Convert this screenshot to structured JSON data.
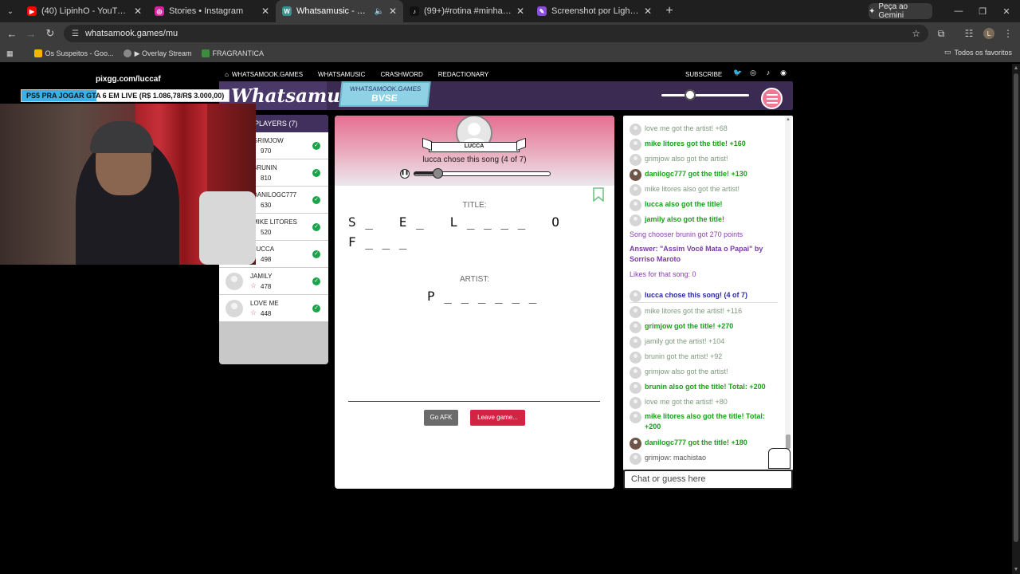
{
  "browser": {
    "tabs": [
      {
        "title": "(40) LipinhO - YouTube",
        "icon": "youtube-icon",
        "color": "#ff0000"
      },
      {
        "title": "Stories • Instagram",
        "icon": "instagram-icon",
        "color": "#d6249f"
      },
      {
        "title": "Whatsamusic - Name That",
        "icon": "whatsamusic-icon",
        "color": "#3a8f8f"
      },
      {
        "title": "(99+)#rotina #minharotina #fo",
        "icon": "tiktok-icon",
        "color": "#111111"
      },
      {
        "title": "Screenshot por Lightshot",
        "icon": "lightshot-icon",
        "color": "#8a4fd8"
      }
    ],
    "gemini_label": "Peça ao Gemini",
    "url": "whatsamook.games/mu",
    "bookmarks": [
      "Os Suspeitos - Goo...",
      "▶ Overlay Stream",
      "FRAGRANTICA"
    ],
    "all_bookmarks": "Todos os favoritos"
  },
  "stream_overlay": {
    "url": "pixgg.com/luccaf",
    "goal_text": "PS5 PRA JOGAR GTA 6 EM LIVE (R$ 1.086,78/R$ 3.000,00)",
    "goal_progress": 0.362
  },
  "site": {
    "nav": [
      "WHATSAMOOK.GAMES",
      "WHATSAMUSIC",
      "CRASHWORD",
      "REDACTIONARY"
    ],
    "subscribe": "SUBSCRIBE",
    "logo": "Whatsamusic",
    "room_label": "WHATSAMOOK.GAMES",
    "room_code": "BVSE",
    "volume_level": 0.3
  },
  "players": {
    "header": "PLAYERS (7)",
    "list": [
      {
        "name": "GRIMJOW",
        "points": "970"
      },
      {
        "name": "BRUNIN",
        "points": "810"
      },
      {
        "name": "DANILOGC777",
        "points": "630"
      },
      {
        "name": "MIKE LITORES",
        "points": "520"
      },
      {
        "name": "LUCCA",
        "points": "498"
      },
      {
        "name": "JAMILY",
        "points": "478"
      },
      {
        "name": "LOVE ME",
        "points": "448"
      }
    ]
  },
  "game": {
    "chooser": "LUCCA",
    "chose_text": "lucca chose this song (4 of 7)",
    "song_progress": 0.18,
    "title_label": "TITLE:",
    "title_line1": "S _   E _   L _ _ _ _   O",
    "title_line2": "F _ _ _",
    "artist_label": "ARTIST:",
    "artist_hint": "P _ _ _ _ _ _",
    "afk_button": "Go AFK",
    "leave_button": "Leave game..."
  },
  "chat": {
    "placeholder": "Chat or guess here",
    "messages": [
      {
        "text": "love me got the artist! +68",
        "style": "gray"
      },
      {
        "text": "mike litores got the title! +160",
        "style": "green"
      },
      {
        "text": "grimjow also got the artist!",
        "style": "gray"
      },
      {
        "text": "danilogc777 got the title! +130",
        "style": "green"
      },
      {
        "text": "mike litores also got the artist!",
        "style": "gray"
      },
      {
        "text": "lucca also got the title!",
        "style": "green"
      },
      {
        "text": "jamily also got the title!",
        "style": "green"
      },
      {
        "text": "Song chooser brunin got 270 points",
        "style": "purple"
      },
      {
        "text": "Answer: \"Assim Você Mata o Papai\" by Sorriso Maroto",
        "style": "purpleb"
      },
      {
        "text": "Likes for that song: 0",
        "style": "purple"
      },
      {
        "text": "lucca chose this song! (4 of 7)",
        "style": "blue"
      },
      {
        "text": "mike litores got the artist! +116",
        "style": "gray"
      },
      {
        "text": "grimjow got the title! +270",
        "style": "green"
      },
      {
        "text": "jamily got the artist! +104",
        "style": "gray"
      },
      {
        "text": "brunin got the artist! +92",
        "style": "gray"
      },
      {
        "text": "grimjow also got the artist!",
        "style": "gray"
      },
      {
        "text": "brunin also got the title! Total: +200",
        "style": "green"
      },
      {
        "text": "love me got the artist! +80",
        "style": "gray"
      },
      {
        "text": "mike litores also got the title! Total: +200",
        "style": "green"
      },
      {
        "text": "danilogc777 got the title! +180",
        "style": "green"
      },
      {
        "text": "grimjow: machistao",
        "style": "plain"
      }
    ]
  }
}
